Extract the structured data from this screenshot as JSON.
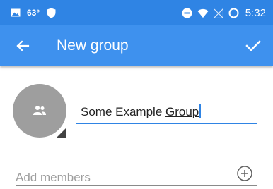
{
  "status_bar": {
    "temperature": "63°",
    "time": "5:32",
    "icons": [
      "image-icon",
      "shield-icon",
      "do-not-disturb-icon",
      "wifi-icon",
      "signal-off-icon",
      "battery-ring-icon"
    ]
  },
  "app_bar": {
    "title": "New group",
    "back_icon": "arrow-back-icon",
    "confirm_icon": "check-icon"
  },
  "group_form": {
    "avatar_icon": "group-icon",
    "name_value_prefix": "Some Example ",
    "name_value_suffix": "Group",
    "add_members_placeholder": "Add members",
    "add_member_icon": "add-circle-icon"
  },
  "colors": {
    "status_bar": "#2F84E4",
    "app_bar": "#3E91EE",
    "accent": "#2F84E4",
    "avatar": "#9E9E9E"
  }
}
